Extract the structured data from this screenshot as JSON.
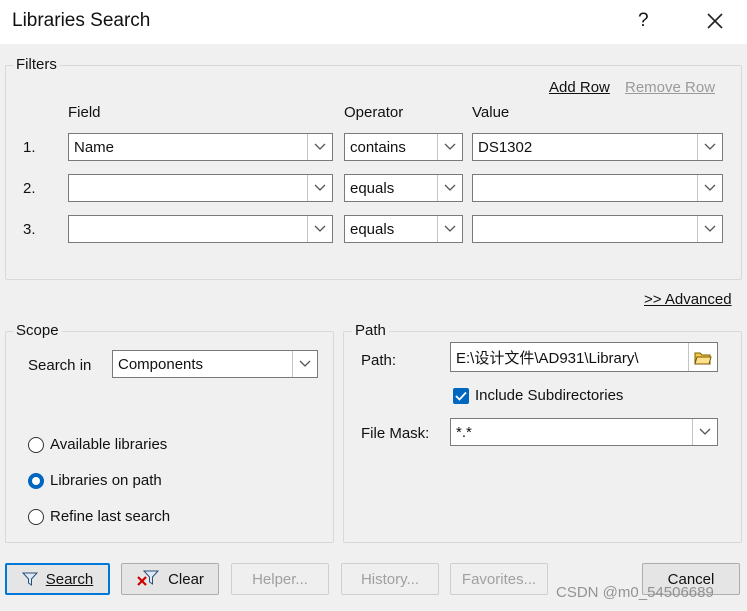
{
  "window": {
    "title": "Libraries Search",
    "help_label": "?"
  },
  "filters": {
    "legend": "Filters",
    "add_row": "Add Row",
    "remove_row": "Remove Row",
    "headers": {
      "field": "Field",
      "operator": "Operator",
      "value": "Value"
    },
    "rows": [
      {
        "num": "1.",
        "field": "Name",
        "operator": "contains",
        "value": "DS1302"
      },
      {
        "num": "2.",
        "field": "",
        "operator": "equals",
        "value": ""
      },
      {
        "num": "3.",
        "field": "",
        "operator": "equals",
        "value": ""
      }
    ]
  },
  "advanced_label": ">> Advanced",
  "scope": {
    "legend": "Scope",
    "search_in_label": "Search in",
    "search_in_value": "Components",
    "options": [
      "Available libraries",
      "Libraries on path",
      "Refine last search"
    ],
    "selected_index": 1
  },
  "path": {
    "legend": "Path",
    "path_label": "Path:",
    "path_value": "E:\\设计文件\\AD931\\Library\\",
    "include_subdirs_label": "Include Subdirectories",
    "include_subdirs_checked": true,
    "file_mask_label": "File Mask:",
    "file_mask_value": "*.*"
  },
  "buttons": {
    "search": "Search",
    "clear": "Clear",
    "helper": "Helper...",
    "history": "History...",
    "favorites": "Favorites...",
    "cancel": "Cancel"
  },
  "watermark": "CSDN @m0_54506689",
  "colors": {
    "accent": "#0067c0",
    "panel": "#f0f0f0",
    "disabled_text": "#9a9a9a"
  }
}
